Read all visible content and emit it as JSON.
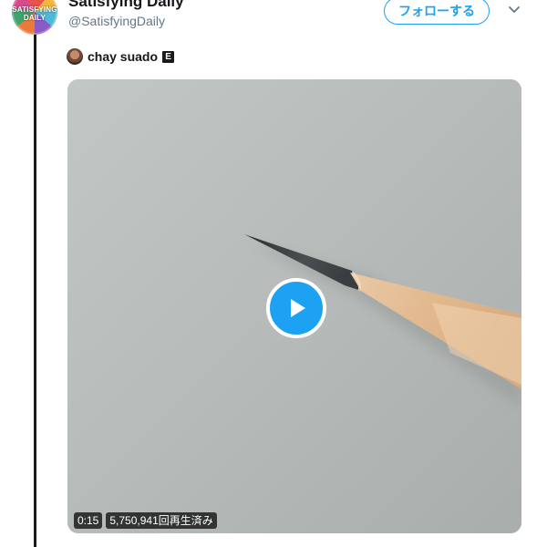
{
  "tweet": {
    "avatar_text_line1": "SATISFYING",
    "avatar_text_line2": "DAILY",
    "display_name": "Satisfying Daily",
    "handle": "@SatisfyingDaily",
    "follow_label": "フォローする"
  },
  "music": {
    "artist": "chay suado",
    "explicit_badge": "E"
  },
  "video": {
    "duration": "0:15",
    "views": "5,750,941回再生済み"
  },
  "colors": {
    "accent": "#1da1f2",
    "text_primary": "#14171a",
    "text_secondary": "#657786"
  },
  "icons": {
    "caret": "chevron-down-icon",
    "play": "play-icon"
  }
}
